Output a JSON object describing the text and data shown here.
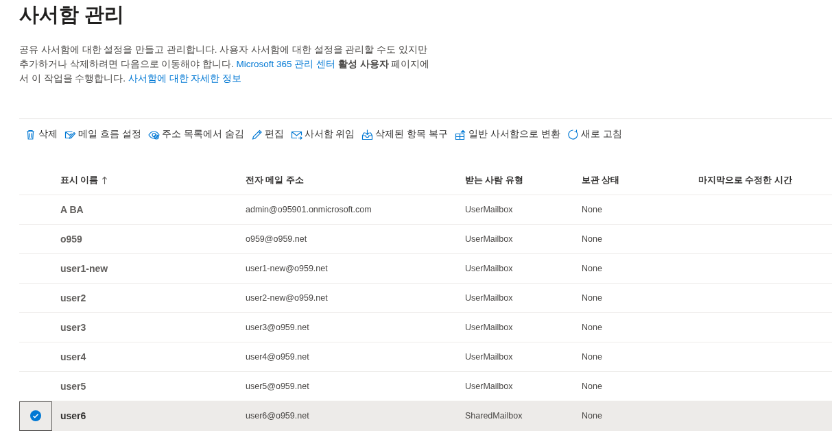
{
  "page": {
    "title": "사서함 관리",
    "description": [
      {
        "kind": "text",
        "text": "공유 사서함에 대한 설정을 만들고 관리합니다. 사용자 사서함에 대한 설정을 관리할 수도 있지만 추가하거나 삭제하려면 다음으로 이동해야 합니다. "
      },
      {
        "kind": "link",
        "text": "Microsoft 365 관리 센터"
      },
      {
        "kind": "text",
        "text": " **활성 사용자** 페이지에서 이 작업을 수행합니다. "
      },
      {
        "kind": "link",
        "text": "사서함에 대한 자세한 정보"
      }
    ]
  },
  "toolbar": [
    {
      "kind": "delete",
      "label": "삭제"
    },
    {
      "kind": "mailflow",
      "label": "메일 흐름 설정"
    },
    {
      "kind": "hide",
      "label": "주소 목록에서 숨김"
    },
    {
      "kind": "edit",
      "label": "편집"
    },
    {
      "kind": "delegate",
      "label": "사서함 위임"
    },
    {
      "kind": "recover",
      "label": "삭제된 항목 복구"
    },
    {
      "kind": "convert",
      "label": "일반 사서함으로 변환"
    },
    {
      "kind": "refresh",
      "label": "새로 고침"
    }
  ],
  "table": {
    "columns": [
      {
        "label": "표시 이름",
        "sorted": true
      },
      {
        "label": "전자 메일 주소",
        "sorted": false
      },
      {
        "label": "받는 사람 유형",
        "sorted": false
      },
      {
        "label": "보관 상태",
        "sorted": false
      },
      {
        "label": "마지막으로 수정한 시간",
        "sorted": false
      }
    ],
    "rows": [
      {
        "selected": false,
        "cells": [
          "A BA",
          "admin@o95901.onmicrosoft.com",
          "UserMailbox",
          "None"
        ]
      },
      {
        "selected": false,
        "cells": [
          "o959",
          "o959@o959.net",
          "UserMailbox",
          "None"
        ]
      },
      {
        "selected": false,
        "cells": [
          "user1-new",
          "user1-new@o959.net",
          "UserMailbox",
          "None"
        ]
      },
      {
        "selected": false,
        "cells": [
          "user2",
          "user2-new@o959.net",
          "UserMailbox",
          "None"
        ]
      },
      {
        "selected": false,
        "cells": [
          "user3",
          "user3@o959.net",
          "UserMailbox",
          "None"
        ]
      },
      {
        "selected": false,
        "cells": [
          "user4",
          "user4@o959.net",
          "UserMailbox",
          "None"
        ]
      },
      {
        "selected": false,
        "cells": [
          "user5",
          "user5@o959.net",
          "UserMailbox",
          "None"
        ]
      },
      {
        "selected": true,
        "cells": [
          "user6",
          "user6@o959.net",
          "SharedMailbox",
          "None"
        ]
      }
    ]
  }
}
